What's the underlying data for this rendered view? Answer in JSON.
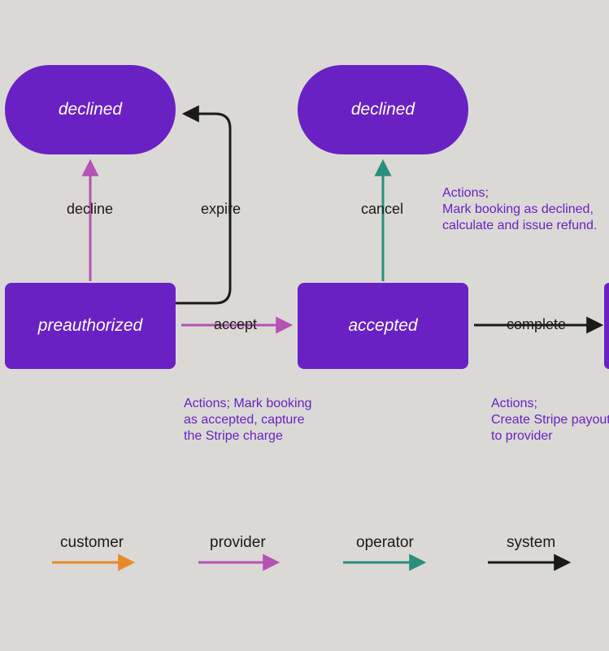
{
  "states": {
    "declined1": "declined",
    "declined2": "declined",
    "preauthorized": "preauthorized",
    "accepted": "accepted"
  },
  "edges": {
    "decline": "decline",
    "expire": "expire",
    "cancel": "cancel",
    "accept": "accept",
    "complete": "complete"
  },
  "notes": {
    "cancel": "Actions;\nMark booking as declined, calculate and issue refund.",
    "accept": "Actions; Mark booking as accepted, capture the Stripe charge",
    "complete": "Actions;\nCreate Stripe payout to provider"
  },
  "legend": {
    "customer": "customer",
    "provider": "provider",
    "operator": "operator",
    "system": "system"
  },
  "colors": {
    "purple_state": "#6a21c4",
    "provider": "#b552b5",
    "operator": "#2a8f7c",
    "customer": "#e88a2a",
    "system": "#1a1a1a"
  }
}
